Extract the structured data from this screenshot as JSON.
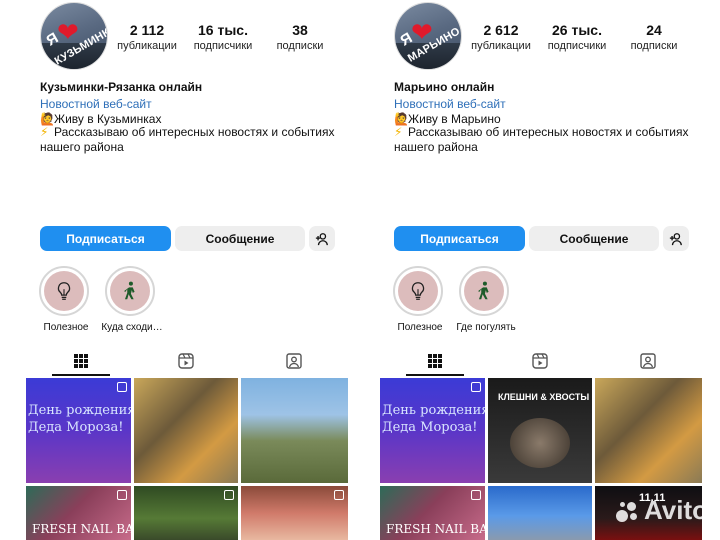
{
  "left": {
    "avatar": {
      "heart_text": "❤",
      "ya": "Я",
      "place": "КУЗЬМИНКИ"
    },
    "stats": [
      {
        "num": "2 112",
        "label": "публикации"
      },
      {
        "num": "16 тыс.",
        "label": "подписчики"
      },
      {
        "num": "38",
        "label": "подписки"
      }
    ],
    "name": "Кузьминки-Рязанка онлайн",
    "category": "Новостной веб-сайт",
    "bio_line1": "Живу в Кузьминках",
    "bio_line2": "Рассказываю об интересных новостях и событиях нашего района",
    "follow_label": "Подписаться",
    "message_label": "Сообщение",
    "highlights": [
      {
        "label": "Полезное",
        "icon": "lightbulb-icon"
      },
      {
        "label": "Куда сходи…",
        "icon": "walking-person-icon"
      }
    ],
    "tiles": [
      {
        "caption": "День рождения\nДеда Мороза!",
        "style": "purple",
        "badge": true
      },
      {
        "caption": "",
        "style": "tree",
        "badge": false
      },
      {
        "caption": "",
        "style": "park",
        "badge": false
      },
      {
        "caption": "FRESH NAIL BAR",
        "style": "nail",
        "badge": true
      },
      {
        "caption": "",
        "style": "green",
        "badge": true
      },
      {
        "caption": "",
        "style": "party",
        "badge": true
      }
    ]
  },
  "right": {
    "avatar": {
      "heart_text": "❤",
      "ya": "Я",
      "place": "МАРЬИНО"
    },
    "stats": [
      {
        "num": "2 612",
        "label": "публикации"
      },
      {
        "num": "26 тыс.",
        "label": "подписчики"
      },
      {
        "num": "24",
        "label": "подписки"
      }
    ],
    "name": "Марьино онлайн",
    "category": "Новостной веб-сайт",
    "bio_line1": "Живу в Марьино",
    "bio_line2": "Рассказываю об интересных новостях и событиях нашего района",
    "follow_label": "Подписаться",
    "message_label": "Сообщение",
    "highlights": [
      {
        "label": "Полезное",
        "icon": "lightbulb-icon"
      },
      {
        "label": "Где погулять",
        "icon": "walking-person-icon"
      }
    ],
    "tiles": [
      {
        "caption": "День рождения\nДеда Мороза!",
        "style": "purple",
        "badge": true
      },
      {
        "caption": "КЛЕШНИ & ХВОСТЫ",
        "style": "dark",
        "badge": false
      },
      {
        "caption": "",
        "style": "tree",
        "badge": false
      },
      {
        "caption": "FRESH NAIL BAR",
        "style": "nail",
        "badge": true
      },
      {
        "caption": "",
        "style": "sky",
        "badge": false
      },
      {
        "caption": "11.11",
        "style": "car",
        "badge": false
      }
    ]
  },
  "watermark": "Avito",
  "colors": {
    "accent": "#1f8ff0",
    "link": "#2e6fb8",
    "button_gray": "#eeeeee"
  }
}
